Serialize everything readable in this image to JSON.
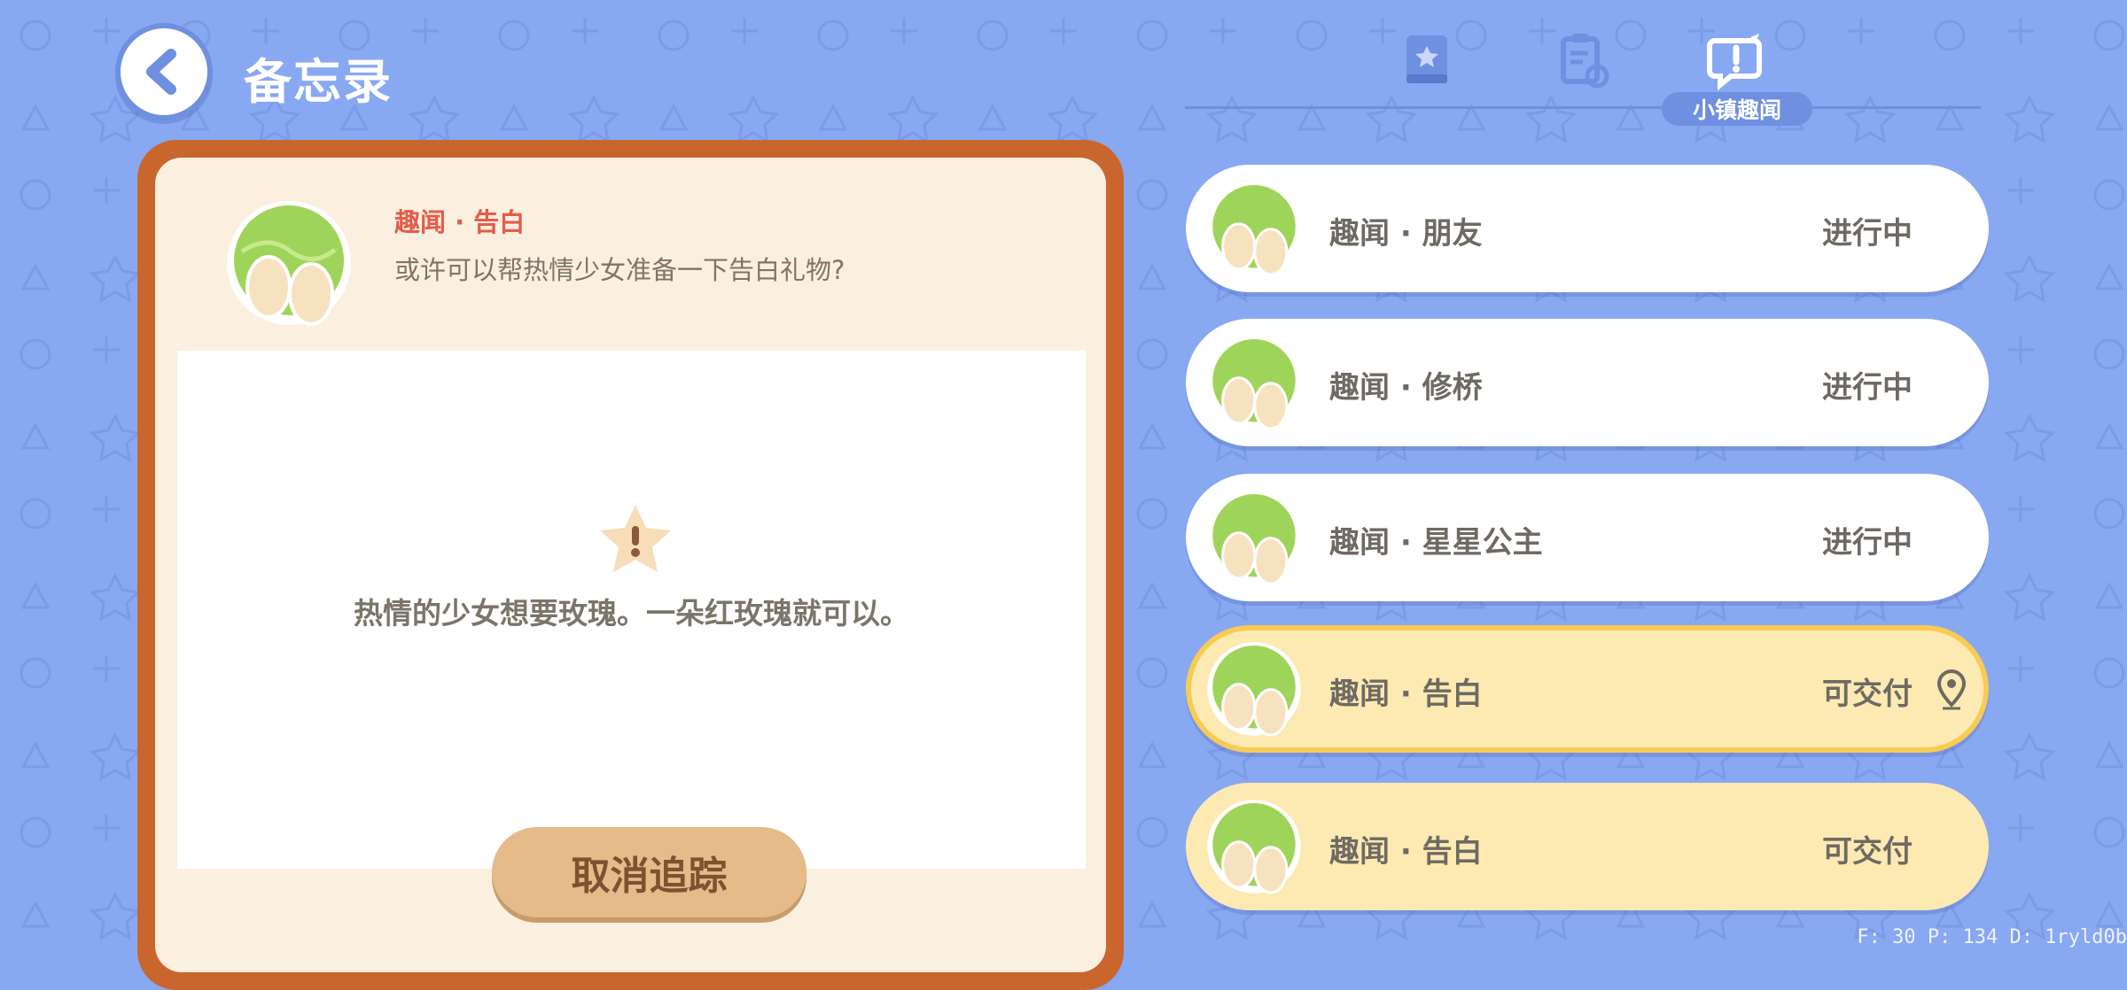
{
  "header": {
    "title": "备忘录"
  },
  "tabs": {
    "active_label": "小镇趣闻"
  },
  "detail": {
    "title": "趣闻 · 告白",
    "subtitle": "或许可以帮热情少女准备一下告白礼物?",
    "message": "热情的少女想要玫瑰。一朵红玫瑰就可以。",
    "cancel_label": "取消追踪"
  },
  "quests": [
    {
      "name": "趣闻 · 朋友",
      "status": "进行中"
    },
    {
      "name": "趣闻 · 修桥",
      "status": "进行中"
    },
    {
      "name": "趣闻 · 星星公主",
      "status": "进行中"
    },
    {
      "name": "趣闻 · 告白",
      "status": "可交付"
    },
    {
      "name": "趣闻 · 告白",
      "status": "可交付"
    }
  ],
  "debug": {
    "text": "F: 30   P: 134   D: 1ryld0b"
  },
  "colors": {
    "background": "#88a8f2",
    "frame": "#c9662e",
    "deliverable": "#fdeab2",
    "highlight_border": "#f7cb54",
    "accent_red": "#e55b4b"
  }
}
